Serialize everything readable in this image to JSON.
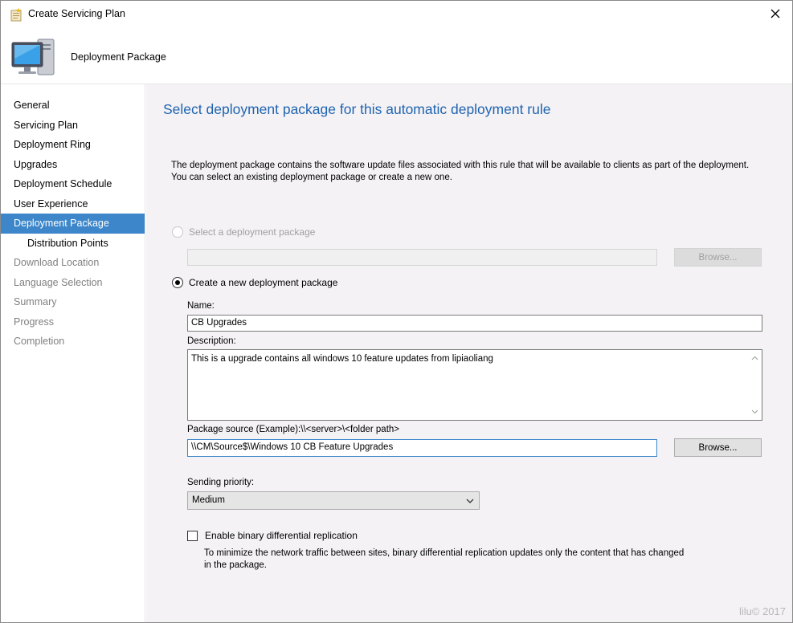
{
  "window": {
    "title": "Create Servicing Plan",
    "banner_title": "Deployment Package"
  },
  "nav": {
    "items": [
      {
        "label": "General",
        "state": "normal"
      },
      {
        "label": "Servicing Plan",
        "state": "normal"
      },
      {
        "label": "Deployment Ring",
        "state": "normal"
      },
      {
        "label": "Upgrades",
        "state": "normal"
      },
      {
        "label": "Deployment Schedule",
        "state": "normal"
      },
      {
        "label": "User Experience",
        "state": "normal"
      },
      {
        "label": "Deployment Package",
        "state": "active"
      },
      {
        "label": "Distribution Points",
        "state": "sub"
      },
      {
        "label": "Download Location",
        "state": "disabled"
      },
      {
        "label": "Language Selection",
        "state": "disabled"
      },
      {
        "label": "Summary",
        "state": "disabled"
      },
      {
        "label": "Progress",
        "state": "disabled"
      },
      {
        "label": "Completion",
        "state": "disabled"
      }
    ]
  },
  "main": {
    "heading": "Select deployment package for this automatic deployment rule",
    "intro_line1": "The deployment package contains the software update files associated with this rule that will be available to clients as part of the deployment.",
    "intro_line2": "You can select an existing deployment package or create a new one.",
    "select_existing_label": "Select a deployment package",
    "select_existing_value": "",
    "browse_label": "Browse...",
    "create_new_label": "Create a new deployment package",
    "name_label": "Name:",
    "name_value": "CB Upgrades",
    "description_label": "Description:",
    "description_value": "This is a upgrade contains all windows 10 feature updates from lipiaoliang",
    "source_label": "Package source (Example):\\\\<server>\\<folder path>",
    "source_value": "\\\\CM\\Source$\\Windows 10 CB Feature Upgrades",
    "browse2_label": "Browse...",
    "priority_label": "Sending priority:",
    "priority_value": "Medium",
    "binary_label": "Enable binary differential replication",
    "binary_checked": false,
    "binary_help_line1": "To minimize the network traffic between sites, binary differential replication updates only the content that has changed",
    "binary_help_line2": "in the package."
  },
  "watermark": "lilu© 2017",
  "colors": {
    "accent": "#3c86c9",
    "heading": "#1f64b0",
    "content_bg": "#f4f2f5"
  },
  "icons": {
    "title": "wizard-icon",
    "banner": "computer-monitor-icon",
    "close": "close-icon"
  }
}
